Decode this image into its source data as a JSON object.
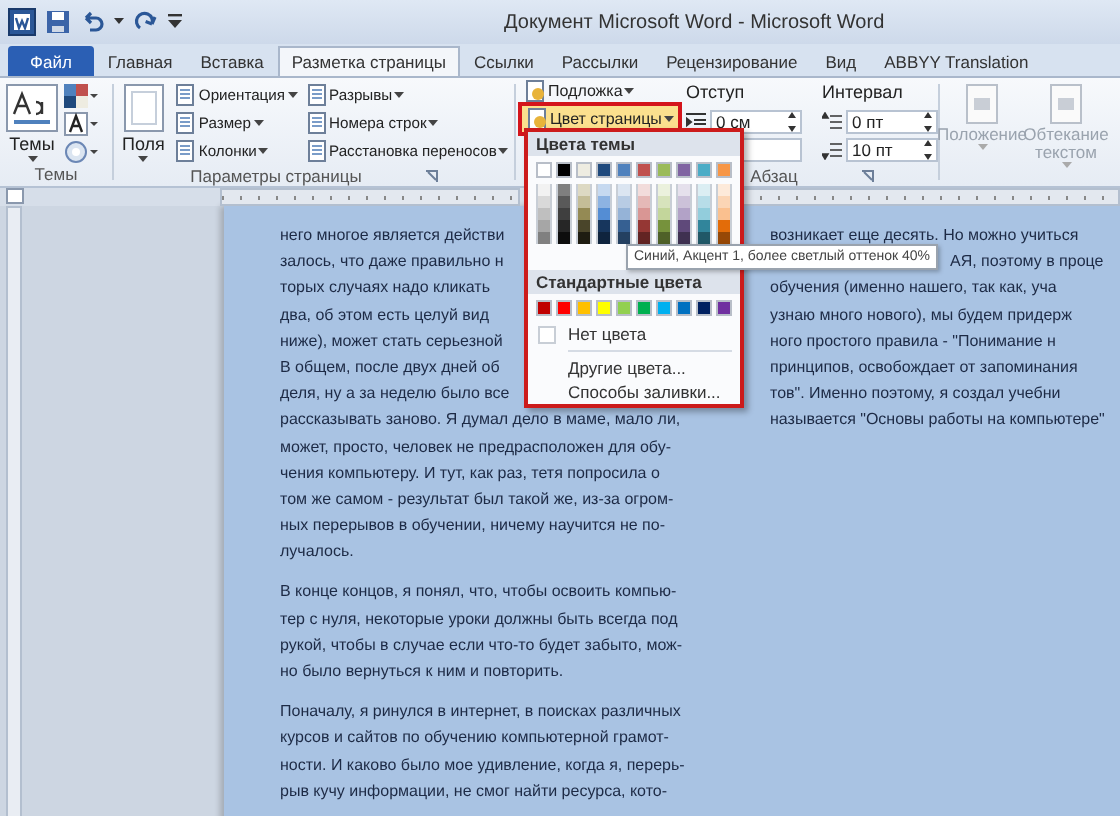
{
  "title_bar": {
    "title": "Документ Microsoft Word - Microsoft Word"
  },
  "tabs": [
    {
      "label": "Файл",
      "kind": "file",
      "selected": false
    },
    {
      "label": "Главная",
      "kind": "tab",
      "selected": false
    },
    {
      "label": "Вставка",
      "kind": "tab",
      "selected": false
    },
    {
      "label": "Разметка страницы",
      "kind": "tab",
      "selected": true
    },
    {
      "label": "Ссылки",
      "kind": "tab",
      "selected": false
    },
    {
      "label": "Рассылки",
      "kind": "tab",
      "selected": false
    },
    {
      "label": "Рецензирование",
      "kind": "tab",
      "selected": false
    },
    {
      "label": "Вид",
      "kind": "tab",
      "selected": false
    },
    {
      "label": "ABBYY Translation",
      "kind": "tab",
      "selected": false
    }
  ],
  "ribbon": {
    "themes": {
      "label": "Темы",
      "button": "Темы"
    },
    "page_setup": {
      "label": "Параметры страницы",
      "button": "Поля",
      "commands": [
        {
          "label": "Ориентация"
        },
        {
          "label": "Размер"
        },
        {
          "label": "Колонки"
        },
        {
          "label": "Разрывы"
        },
        {
          "label": "Номера строк"
        },
        {
          "label": "Расстановка переносов"
        }
      ]
    },
    "page_background": {
      "commands": [
        {
          "label": "Подложка",
          "highlighted": false
        },
        {
          "label": "Цвет страницы",
          "highlighted": true
        }
      ]
    },
    "paragraph": {
      "label": "Абзац",
      "indent": {
        "label": "Отступ",
        "value": "0 см"
      },
      "spacing": {
        "label": "Интервал",
        "before": "0 пт",
        "after": "10 пт"
      }
    },
    "arrange": {
      "commands": [
        {
          "label": "Положение",
          "disabled": true
        },
        {
          "label": "Обтекание текстом",
          "disabled": true
        }
      ]
    }
  },
  "page_color_menu": {
    "theme_header": "Цвета темы",
    "theme_colors": [
      {
        "color": "#ffffff",
        "shades": [
          {
            "color": "#f2f2f2"
          },
          {
            "color": "#d9d9d9"
          },
          {
            "color": "#bfbfbf"
          },
          {
            "color": "#a6a6a6"
          },
          {
            "color": "#808080"
          }
        ]
      },
      {
        "color": "#000000",
        "shades": [
          {
            "color": "#7f7f7f"
          },
          {
            "color": "#595959"
          },
          {
            "color": "#3f3f3f"
          },
          {
            "color": "#262626"
          },
          {
            "color": "#0d0d0d"
          }
        ]
      },
      {
        "color": "#eeece1",
        "shades": [
          {
            "color": "#ddd9c3"
          },
          {
            "color": "#c4bd97"
          },
          {
            "color": "#948a54"
          },
          {
            "color": "#4a452a"
          },
          {
            "color": "#1e1c11"
          }
        ]
      },
      {
        "color": "#1f497d",
        "shades": [
          {
            "color": "#c6d9f0"
          },
          {
            "color": "#8db3e2"
          },
          {
            "color": "#548dd4"
          },
          {
            "color": "#17365d"
          },
          {
            "color": "#0f243e"
          }
        ]
      },
      {
        "color": "#4f81bd",
        "shades": [
          {
            "color": "#dbe5f1"
          },
          {
            "color": "#b8cce4"
          },
          {
            "color": "#95b3d7"
          },
          {
            "color": "#366092"
          },
          {
            "color": "#244061"
          }
        ]
      },
      {
        "color": "#c0504d",
        "shades": [
          {
            "color": "#f2dcdb"
          },
          {
            "color": "#e5b9b7"
          },
          {
            "color": "#d99694"
          },
          {
            "color": "#953734"
          },
          {
            "color": "#632423"
          }
        ]
      },
      {
        "color": "#9bbb59",
        "shades": [
          {
            "color": "#ebf1dd"
          },
          {
            "color": "#d7e3bc"
          },
          {
            "color": "#c3d69b"
          },
          {
            "color": "#76923c"
          },
          {
            "color": "#4f6128"
          }
        ]
      },
      {
        "color": "#8064a2",
        "shades": [
          {
            "color": "#e5e0ec"
          },
          {
            "color": "#ccc1d9"
          },
          {
            "color": "#b2a2c7"
          },
          {
            "color": "#5f497a"
          },
          {
            "color": "#3f3151"
          }
        ]
      },
      {
        "color": "#4bacc6",
        "shades": [
          {
            "color": "#dbeef3"
          },
          {
            "color": "#b7dde8"
          },
          {
            "color": "#92cddc"
          },
          {
            "color": "#31859b"
          },
          {
            "color": "#205867"
          }
        ]
      },
      {
        "color": "#f79646",
        "shades": [
          {
            "color": "#fdeada"
          },
          {
            "color": "#fbd5b5"
          },
          {
            "color": "#fac08f"
          },
          {
            "color": "#e36c09"
          },
          {
            "color": "#974806"
          }
        ]
      }
    ],
    "standard_header": "Стандартные цвета",
    "standard_colors": [
      {
        "color": "#c00000"
      },
      {
        "color": "#ff0000"
      },
      {
        "color": "#ffc000"
      },
      {
        "color": "#ffff00"
      },
      {
        "color": "#92d050"
      },
      {
        "color": "#00b050"
      },
      {
        "color": "#00b0f0"
      },
      {
        "color": "#0070c0"
      },
      {
        "color": "#002060"
      },
      {
        "color": "#7030a0"
      }
    ],
    "items": [
      {
        "label": "Нет цвета",
        "kind": "no_color"
      },
      {
        "label": "Другие цвета...",
        "kind": "more"
      },
      {
        "label": "Способы заливки...",
        "kind": "fill"
      }
    ]
  },
  "tooltip": {
    "text": "Синий, Акцент 1, более светлый оттенок 40%"
  },
  "document": {
    "left_column": [
      [
        "него многое является действи",
        "залось, что даже правильно н",
        "торых случаях надо кликать",
        "два, об этом есть целуй вид",
        "ниже), может стать серьезной",
        "В общем, после двух дней об",
        "деля, ну а за неделю было все",
        "рассказывать заново. Я думал дело в маме, мало ли,",
        "может, просто, человек не предрасположен для обу-",
        "чения компьютеру. И тут, как раз, тетя попросила о",
        "том же самом - результат был такой же, из-за огром-",
        "ных перерывов в обучении, ничему научится не по-",
        "лучалось."
      ],
      [
        "В конце концов, я понял, что, чтобы освоить компью-",
        "тер с нуля, некоторые уроки должны быть всегда под",
        "рукой, чтобы в случае если что-то будет забыто, мож-",
        "но было вернуться к ним и повторить."
      ],
      [
        "Поначалу, я ринулся в интернет, в поисках различных",
        "курсов и сайтов по обучению компьютерной грамот-",
        "ности. И каково было мое удивление, когда я, перерь-",
        "рыв кучу информации, не смог найти ресурса, кото-"
      ]
    ],
    "right_column": [
      {
        "text": "возникает еще десять. Но можно учиться",
        "covered": false
      },
      {
        "text": "АЯ, поэтому в проце",
        "covered": true
      },
      {
        "text": "обучения (именно нашего, так как, уча",
        "covered": false
      },
      {
        "text": "узнаю много нового), мы будем придерж",
        "covered": false
      },
      {
        "text": "ного простого правила - \"Понимание н",
        "covered": false
      },
      {
        "text": "принципов, освобождает от запоминания",
        "covered": false
      },
      {
        "text": "тов\". Именно поэтому, я создал учебни",
        "covered": false
      },
      {
        "text": "называется \"Основы работы на компьютере\"",
        "covered": false
      }
    ]
  }
}
